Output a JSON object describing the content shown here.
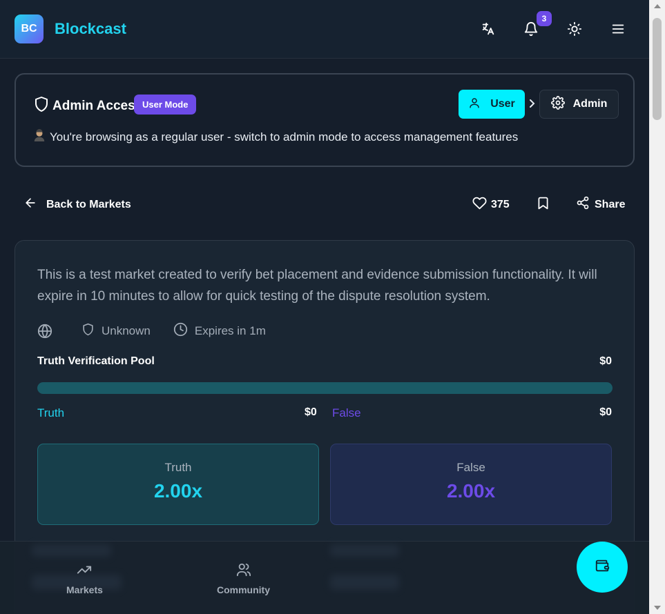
{
  "header": {
    "logo_text": "BC",
    "brand": "Blockcast",
    "notification_count": "3",
    "icons": [
      "translate-icon",
      "bell-icon",
      "sun-icon",
      "menu-icon"
    ]
  },
  "admin": {
    "title": "Admin Access",
    "mode_badge": "User Mode",
    "description": "You're browsing as a regular user - switch to admin mode to access management features",
    "user_button": "User",
    "admin_button": "Admin"
  },
  "nav": {
    "back_label": "Back to Markets",
    "likes": "375",
    "share_label": "Share"
  },
  "market": {
    "description": "This is a test market created to verify bet placement and evidence submission functionality. It will expire in 10 minutes to allow for quick testing of the dispute resolution system.",
    "source": "Unknown",
    "expires": "Expires in 1m",
    "pool_title": "Truth Verification Pool",
    "pool_amount": "$0",
    "pool_truth_fraction": 0.5,
    "truth_label": "Truth",
    "truth_amount": "$0",
    "false_label": "False",
    "false_amount": "$0",
    "options": [
      {
        "label": "Truth",
        "odds": "2.00x"
      },
      {
        "label": "False",
        "odds": "2.00x"
      }
    ]
  },
  "bottom_nav": {
    "markets": "Markets",
    "community": "Community"
  },
  "colors": {
    "accent_cyan": "#22d3ee",
    "accent_purple": "#6d4be8",
    "background": "#151e2b"
  }
}
